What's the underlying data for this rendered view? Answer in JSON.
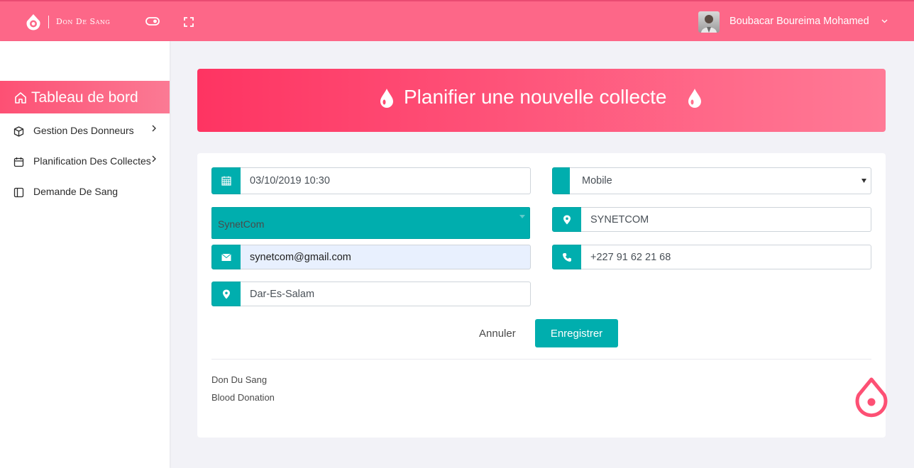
{
  "header": {
    "brand": "Don De Sang",
    "user_name": "Boubacar Boureima Mohamed"
  },
  "sidebar": {
    "items": [
      {
        "label": "Tableau de bord",
        "icon": "home-icon",
        "active": true
      },
      {
        "label": "Gestion Des Donneurs",
        "icon": "box-icon",
        "has_submenu": true
      },
      {
        "label": "Planification Des Collectes",
        "icon": "calendar-icon",
        "has_submenu": true
      },
      {
        "label": "Demande De Sang",
        "icon": "layout-icon",
        "has_submenu": false
      }
    ]
  },
  "banner": {
    "title": "Planifier une nouvelle collecte"
  },
  "form": {
    "datetime": "03/10/2019 10:30",
    "type": "Mobile",
    "organisation": "SynetCom",
    "location_name": "SYNETCOM",
    "email": "synetcom@gmail.com",
    "phone": "+227 91 62 21 68",
    "address": "Dar-Es-Salam",
    "cancel_label": "Annuler",
    "save_label": "Enregistrer"
  },
  "footer": {
    "line1": "Don Du Sang",
    "line2": "Blood Donation"
  },
  "colors": {
    "brand_pink": "#fd6788",
    "accent_teal": "#00aeae",
    "autofill_blue": "#e8f0fe"
  }
}
